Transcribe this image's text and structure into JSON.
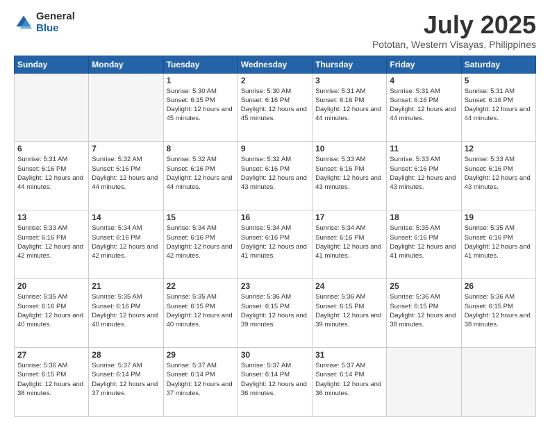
{
  "logo": {
    "general": "General",
    "blue": "Blue"
  },
  "title": "July 2025",
  "subtitle": "Pototan, Western Visayas, Philippines",
  "days_of_week": [
    "Sunday",
    "Monday",
    "Tuesday",
    "Wednesday",
    "Thursday",
    "Friday",
    "Saturday"
  ],
  "weeks": [
    [
      {
        "day": "",
        "empty": true
      },
      {
        "day": "",
        "empty": true
      },
      {
        "day": "1",
        "sunrise": "5:30 AM",
        "sunset": "6:15 PM",
        "daylight": "12 hours and 45 minutes."
      },
      {
        "day": "2",
        "sunrise": "5:30 AM",
        "sunset": "6:16 PM",
        "daylight": "12 hours and 45 minutes."
      },
      {
        "day": "3",
        "sunrise": "5:31 AM",
        "sunset": "6:16 PM",
        "daylight": "12 hours and 44 minutes."
      },
      {
        "day": "4",
        "sunrise": "5:31 AM",
        "sunset": "6:16 PM",
        "daylight": "12 hours and 44 minutes."
      },
      {
        "day": "5",
        "sunrise": "5:31 AM",
        "sunset": "6:16 PM",
        "daylight": "12 hours and 44 minutes."
      }
    ],
    [
      {
        "day": "6",
        "sunrise": "5:31 AM",
        "sunset": "6:16 PM",
        "daylight": "12 hours and 44 minutes."
      },
      {
        "day": "7",
        "sunrise": "5:32 AM",
        "sunset": "6:16 PM",
        "daylight": "12 hours and 44 minutes."
      },
      {
        "day": "8",
        "sunrise": "5:32 AM",
        "sunset": "6:16 PM",
        "daylight": "12 hours and 44 minutes."
      },
      {
        "day": "9",
        "sunrise": "5:32 AM",
        "sunset": "6:16 PM",
        "daylight": "12 hours and 43 minutes."
      },
      {
        "day": "10",
        "sunrise": "5:33 AM",
        "sunset": "6:16 PM",
        "daylight": "12 hours and 43 minutes."
      },
      {
        "day": "11",
        "sunrise": "5:33 AM",
        "sunset": "6:16 PM",
        "daylight": "12 hours and 43 minutes."
      },
      {
        "day": "12",
        "sunrise": "5:33 AM",
        "sunset": "6:16 PM",
        "daylight": "12 hours and 43 minutes."
      }
    ],
    [
      {
        "day": "13",
        "sunrise": "5:33 AM",
        "sunset": "6:16 PM",
        "daylight": "12 hours and 42 minutes."
      },
      {
        "day": "14",
        "sunrise": "5:34 AM",
        "sunset": "6:16 PM",
        "daylight": "12 hours and 42 minutes."
      },
      {
        "day": "15",
        "sunrise": "5:34 AM",
        "sunset": "6:16 PM",
        "daylight": "12 hours and 42 minutes."
      },
      {
        "day": "16",
        "sunrise": "5:34 AM",
        "sunset": "6:16 PM",
        "daylight": "12 hours and 41 minutes."
      },
      {
        "day": "17",
        "sunrise": "5:34 AM",
        "sunset": "6:16 PM",
        "daylight": "12 hours and 41 minutes."
      },
      {
        "day": "18",
        "sunrise": "5:35 AM",
        "sunset": "6:16 PM",
        "daylight": "12 hours and 41 minutes."
      },
      {
        "day": "19",
        "sunrise": "5:35 AM",
        "sunset": "6:16 PM",
        "daylight": "12 hours and 41 minutes."
      }
    ],
    [
      {
        "day": "20",
        "sunrise": "5:35 AM",
        "sunset": "6:16 PM",
        "daylight": "12 hours and 40 minutes."
      },
      {
        "day": "21",
        "sunrise": "5:35 AM",
        "sunset": "6:16 PM",
        "daylight": "12 hours and 40 minutes."
      },
      {
        "day": "22",
        "sunrise": "5:35 AM",
        "sunset": "6:15 PM",
        "daylight": "12 hours and 40 minutes."
      },
      {
        "day": "23",
        "sunrise": "5:36 AM",
        "sunset": "6:15 PM",
        "daylight": "12 hours and 39 minutes."
      },
      {
        "day": "24",
        "sunrise": "5:36 AM",
        "sunset": "6:15 PM",
        "daylight": "12 hours and 39 minutes."
      },
      {
        "day": "25",
        "sunrise": "5:36 AM",
        "sunset": "6:15 PM",
        "daylight": "12 hours and 38 minutes."
      },
      {
        "day": "26",
        "sunrise": "5:36 AM",
        "sunset": "6:15 PM",
        "daylight": "12 hours and 38 minutes."
      }
    ],
    [
      {
        "day": "27",
        "sunrise": "5:36 AM",
        "sunset": "6:15 PM",
        "daylight": "12 hours and 38 minutes."
      },
      {
        "day": "28",
        "sunrise": "5:37 AM",
        "sunset": "6:14 PM",
        "daylight": "12 hours and 37 minutes."
      },
      {
        "day": "29",
        "sunrise": "5:37 AM",
        "sunset": "6:14 PM",
        "daylight": "12 hours and 37 minutes."
      },
      {
        "day": "30",
        "sunrise": "5:37 AM",
        "sunset": "6:14 PM",
        "daylight": "12 hours and 36 minutes."
      },
      {
        "day": "31",
        "sunrise": "5:37 AM",
        "sunset": "6:14 PM",
        "daylight": "12 hours and 36 minutes."
      },
      {
        "day": "",
        "empty": true
      },
      {
        "day": "",
        "empty": true
      }
    ]
  ]
}
